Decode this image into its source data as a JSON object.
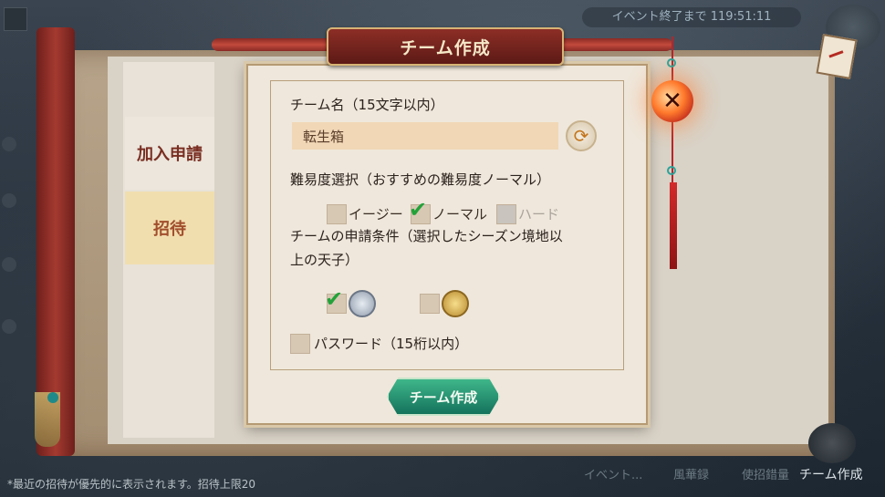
{
  "header": {
    "event_timer": "イベント終了まで 119:51:11"
  },
  "dialog": {
    "title": "チーム作成",
    "team_name_label": "チーム名（15文字以内）",
    "team_name_value": "転生箱",
    "difficulty_label": "難易度選択（おすすめの難易度ノーマル）",
    "difficulty_options": [
      {
        "label": "イージー",
        "checked": false,
        "enabled": true
      },
      {
        "label": "ノーマル",
        "checked": true,
        "enabled": true
      },
      {
        "label": "ハード",
        "checked": false,
        "enabled": false
      }
    ],
    "condition_label_line1": "チームの申請条件（選択したシーズン境地以",
    "condition_label_line2": "上の天子）",
    "condition_options": [
      {
        "icon": "silver-rank-icon",
        "checked": true
      },
      {
        "icon": "gold-rank-icon",
        "checked": false
      }
    ],
    "password_label": "パスワード（15桁以内）",
    "create_button": "チーム作成"
  },
  "side_tabs": {
    "join": "加入申請",
    "invite": "招待"
  },
  "footer": {
    "hint": "*最近の招待が優先的に表示されます。招待上限20",
    "nav": [
      "イベント...",
      "風華録",
      "使招錯量",
      "チーム作成"
    ]
  },
  "colors": {
    "accent_green": "#23a23a",
    "banner_red": "#8c2e26",
    "button_teal": "#14735c"
  }
}
